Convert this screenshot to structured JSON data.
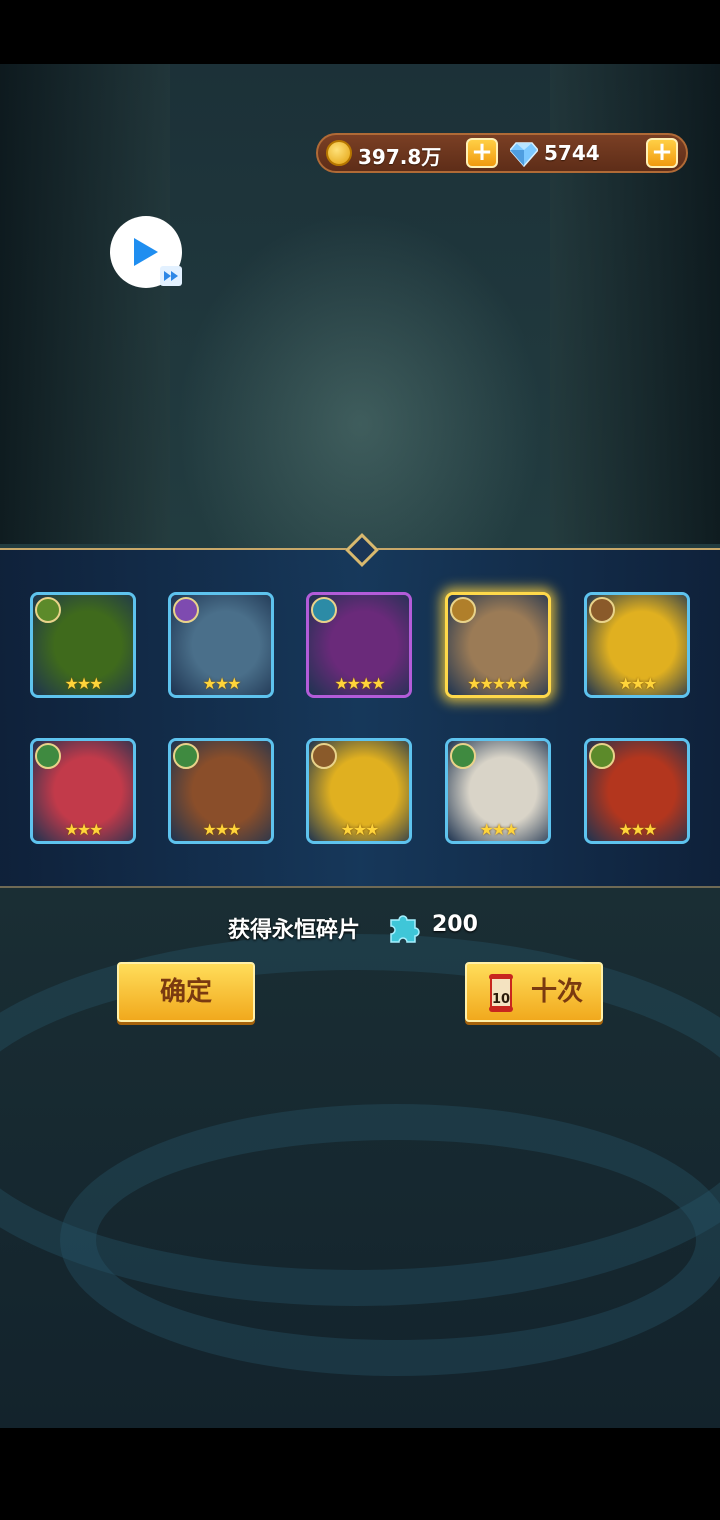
{
  "currency": {
    "coins": "397.8万",
    "gems": "5744",
    "coin_icon": "gold-coin-icon",
    "gem_icon": "diamond-icon"
  },
  "reward": {
    "gain_label": "获得永恒碎片",
    "gain_value": "200",
    "gain_icon": "puzzle-piece-icon"
  },
  "heroes": [
    {
      "name_icon": "green-golem",
      "stars": "★★★",
      "star_count": 3,
      "frame": "blue",
      "color": "#3f6a1c"
    },
    {
      "name_icon": "ice-knight",
      "stars": "★★★",
      "star_count": 3,
      "frame": "blue",
      "color": "#4a6f8a"
    },
    {
      "name_icon": "dark-elf-queen",
      "stars": "★★★★",
      "star_count": 4,
      "frame": "purple",
      "color": "#6a2a7a"
    },
    {
      "name_icon": "bearded-god",
      "stars": "★★★★★",
      "star_count": 5,
      "frame": "gold",
      "color": "#9b7b56"
    },
    {
      "name_icon": "golden-blob",
      "stars": "★★★",
      "star_count": 3,
      "frame": "blue",
      "color": "#e0b020"
    },
    {
      "name_icon": "red-bird",
      "stars": "★★★",
      "star_count": 3,
      "frame": "blue",
      "color": "#c23a4a"
    },
    {
      "name_icon": "werewolf",
      "stars": "★★★",
      "star_count": 3,
      "frame": "blue",
      "color": "#8a4e2a"
    },
    {
      "name_icon": "golden-blob",
      "stars": "★★★",
      "star_count": 3,
      "frame": "blue",
      "color": "#e0b020"
    },
    {
      "name_icon": "eagle",
      "stars": "★★★",
      "star_count": 3,
      "frame": "blue",
      "color": "#d9d4c8"
    },
    {
      "name_icon": "red-ogre",
      "stars": "★★★",
      "star_count": 3,
      "frame": "blue",
      "color": "#b3361e"
    }
  ],
  "buttons": {
    "confirm": "确定",
    "ten_pull": "十次",
    "ten_badge": "10"
  }
}
